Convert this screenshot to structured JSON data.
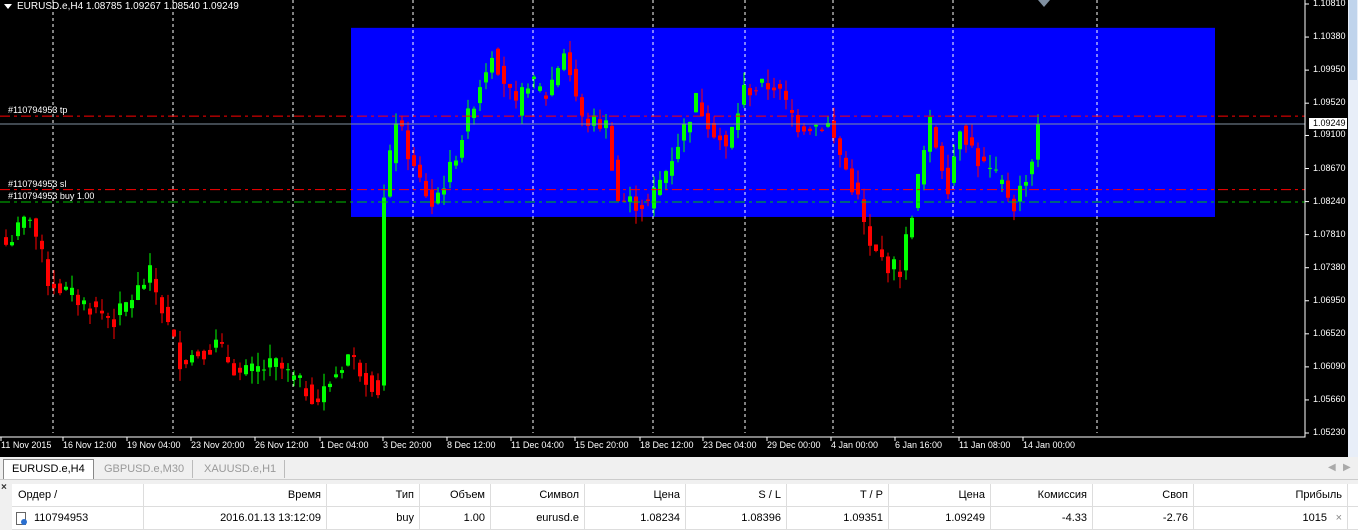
{
  "window": {
    "symbol_info": "EURUSD.e,H4  1.08785 1.09267 1.08540 1.09249"
  },
  "lines": {
    "tp_label": "#110794953 tp",
    "sl_label": "#110794953 sl",
    "buy_label": "#110794953 buy 1.00",
    "tp": 1.09351,
    "sl": 1.08396,
    "buy": 1.08234,
    "bid": 1.09249,
    "bid_label": "1.09249"
  },
  "colors": {
    "bull": "#00ff00",
    "bear": "#ff0000",
    "zone": "#0000ff",
    "tp": "#ff0000",
    "sl": "#ff0000",
    "buy": "#00c000"
  },
  "chart_data": {
    "type": "candlestick",
    "symbol": "EURUSD.e",
    "timeframe": "H4",
    "ylim": [
      1.0523,
      1.1081
    ],
    "y_ticks": [
      "1.10810",
      "1.10380",
      "1.09950",
      "1.09520",
      "1.09100",
      "1.08670",
      "1.08240",
      "1.07810",
      "1.07380",
      "1.06950",
      "1.06520",
      "1.06090",
      "1.05660",
      "1.05230"
    ],
    "x_ticks": [
      "11 Nov 2015",
      "16 Nov 12:00",
      "19 Nov 04:00",
      "23 Nov 20:00",
      "26 Nov 12:00",
      "1 Dec 04:00",
      "3 Dec 20:00",
      "8 Dec 12:00",
      "11 Dec 04:00",
      "15 Dec 20:00",
      "18 Dec 12:00",
      "23 Dec 04:00",
      "29 Dec 00:00",
      "4 Jan 00:00",
      "6 Jan 16:00",
      "11 Jan 08:00",
      "14 Jan 00:00"
    ],
    "zone": {
      "price_top": 1.105,
      "price_bottom": 1.0804,
      "bar_from": 58,
      "bar_to": 202
    },
    "close_path": [
      [
        0,
        1.0768
      ],
      [
        4,
        1.0807
      ],
      [
        7,
        1.0722
      ],
      [
        12,
        1.0696
      ],
      [
        18,
        1.067
      ],
      [
        24,
        1.0729
      ],
      [
        29,
        1.0618
      ],
      [
        35,
        1.0638
      ],
      [
        39,
        1.0599
      ],
      [
        45,
        1.0612
      ],
      [
        52,
        1.0566
      ],
      [
        57,
        1.0625
      ],
      [
        62,
        1.0579
      ],
      [
        63,
        1.0826
      ],
      [
        65,
        1.0933
      ],
      [
        68,
        1.0865
      ],
      [
        71,
        1.082
      ],
      [
        74,
        1.0865
      ],
      [
        78,
        1.0956
      ],
      [
        81,
        1.1021
      ],
      [
        85,
        1.0943
      ],
      [
        87,
        1.0982
      ],
      [
        90,
        1.0962
      ],
      [
        93,
        1.1021
      ],
      [
        96,
        1.093
      ],
      [
        100,
        1.0924
      ],
      [
        102,
        1.0826
      ],
      [
        107,
        1.082
      ],
      [
        110,
        1.0865
      ],
      [
        115,
        1.0956
      ],
      [
        120,
        1.0891
      ],
      [
        123,
        1.0969
      ],
      [
        128,
        1.0976
      ],
      [
        132,
        1.0924
      ],
      [
        137,
        1.0924
      ],
      [
        140,
        1.0865
      ],
      [
        142,
        1.0826
      ],
      [
        144,
        1.0761
      ],
      [
        147,
        1.0742
      ],
      [
        149,
        1.0735
      ],
      [
        152,
        1.0852
      ],
      [
        154,
        1.0924
      ],
      [
        157,
        1.0846
      ],
      [
        159,
        1.0924
      ],
      [
        162,
        1.0878
      ],
      [
        166,
        1.0846
      ],
      [
        168,
        1.082
      ],
      [
        171,
        1.0878
      ],
      [
        172,
        1.09249
      ]
    ]
  },
  "tabs": [
    "EURUSD.e,H4",
    "GBPUSD.e,M30",
    "XAUUSD.e,H1"
  ],
  "table": {
    "headers": [
      "Ордер  /",
      "Время",
      "Тип",
      "Объем",
      "Символ",
      "Цена",
      "S / L",
      "T / P",
      "Цена",
      "Комиссия",
      "Своп",
      "Прибыль"
    ],
    "rows": [
      [
        "110794953",
        "2016.01.13 13:12:09",
        "buy",
        "1.00",
        "eurusd.e",
        "1.08234",
        "1.08396",
        "1.09351",
        "1.09249",
        "-4.33",
        "-2.76",
        "1015"
      ]
    ]
  }
}
